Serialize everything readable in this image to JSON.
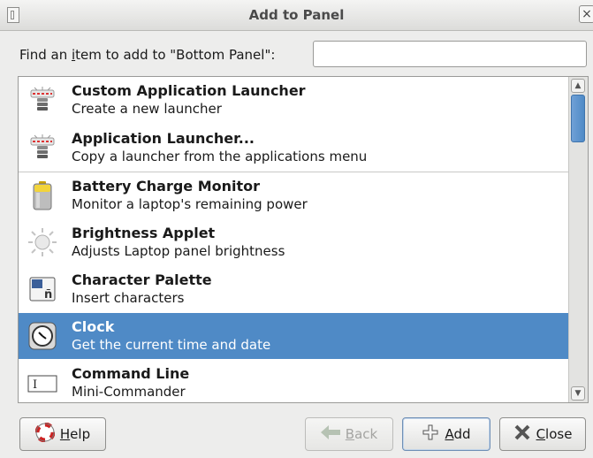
{
  "window": {
    "title": "Add to Panel"
  },
  "search": {
    "label_prefix": "Find an ",
    "label_mnemonic": "i",
    "label_suffix": "tem to add to \"Bottom Panel\":",
    "value": "",
    "placeholder": ""
  },
  "items": [
    {
      "name": "Custom Application Launcher",
      "desc": "Create a new launcher",
      "icon": "launcher-icon"
    },
    {
      "name": "Application Launcher...",
      "desc": "Copy a launcher from the applications menu",
      "icon": "launcher-icon"
    },
    {
      "name": "Battery Charge Monitor",
      "desc": "Monitor a laptop's remaining power",
      "icon": "battery-icon"
    },
    {
      "name": "Brightness Applet",
      "desc": "Adjusts Laptop panel brightness",
      "icon": "brightness-icon"
    },
    {
      "name": "Character Palette",
      "desc": "Insert characters",
      "icon": "character-palette-icon"
    },
    {
      "name": "Clock",
      "desc": "Get the current time and date",
      "icon": "clock-icon",
      "selected": true
    },
    {
      "name": "Command Line",
      "desc": "Mini-Commander",
      "icon": "command-line-icon"
    }
  ],
  "buttons": {
    "help": {
      "mnemonic": "H",
      "rest": "elp"
    },
    "back": {
      "mnemonic": "B",
      "rest": "ack"
    },
    "add": {
      "mnemonic": "A",
      "rest": "dd"
    },
    "close": {
      "mnemonic": "C",
      "rest": "lose"
    }
  },
  "colors": {
    "selection": "#4f8ac6",
    "background": "#ededec"
  }
}
